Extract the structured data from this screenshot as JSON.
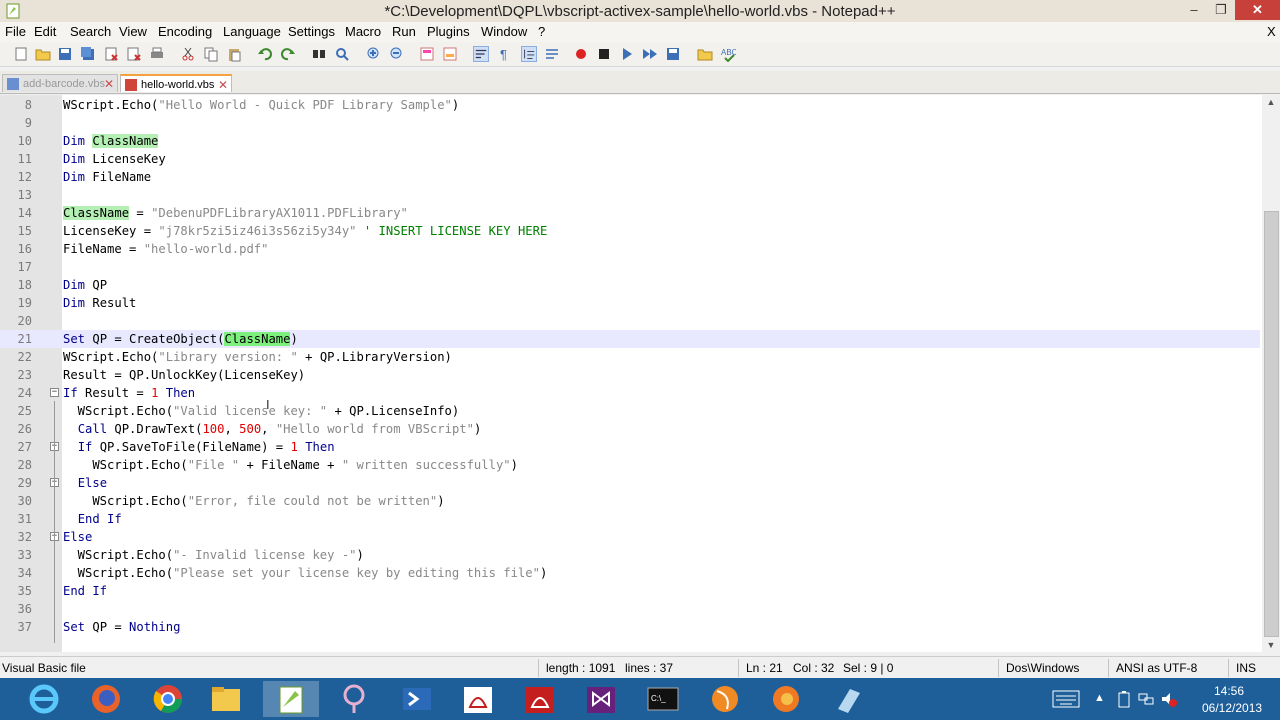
{
  "window": {
    "title": "*C:\\Development\\DQPL\\vbscript-activex-sample\\hello-world.vbs - Notepad++",
    "min": "–",
    "max": "❐",
    "close": "✕"
  },
  "menu": {
    "items": [
      "File",
      "Edit",
      "Search",
      "View",
      "Encoding",
      "Language",
      "Settings",
      "Macro",
      "Run",
      "Plugins",
      "Window",
      "?"
    ],
    "close": "X"
  },
  "tabs": [
    {
      "label": "add-barcode.vbs"
    },
    {
      "label": "hello-world.vbs"
    }
  ],
  "tab_close": "✕",
  "editor": {
    "current_line": 21,
    "lines": [
      {
        "n": "8",
        "html": "WScript.Echo(<span class='str'>\"Hello World - Quick PDF Library Sample\"</span>)"
      },
      {
        "n": "9",
        "html": ""
      },
      {
        "n": "10",
        "html": "<span class='kw'>Dim</span> <span class='bm'>ClassName</span>"
      },
      {
        "n": "11",
        "html": "<span class='kw'>Dim</span> LicenseKey"
      },
      {
        "n": "12",
        "html": "<span class='kw'>Dim</span> FileName"
      },
      {
        "n": "13",
        "html": ""
      },
      {
        "n": "14",
        "html": "<span class='bm'>ClassName</span> = <span class='str'>\"DebenuPDFLibraryAX1011.PDFLibrary\"</span>"
      },
      {
        "n": "15",
        "html": "LicenseKey = <span class='str'>\"j78kr5zi5iz46i3s56zi5y34y\"</span> <span class='cmt'>' INSERT LICENSE KEY HERE</span>"
      },
      {
        "n": "16",
        "html": "FileName = <span class='str'>\"hello-world.pdf\"</span>"
      },
      {
        "n": "17",
        "html": ""
      },
      {
        "n": "18",
        "html": "<span class='kw'>Dim</span> QP"
      },
      {
        "n": "19",
        "html": "<span class='kw'>Dim</span> Result"
      },
      {
        "n": "20",
        "html": ""
      },
      {
        "n": "21",
        "html": "<span class='kw'>Set</span> QP = CreateObject(<span class='hl'>ClassName</span>)"
      },
      {
        "n": "22",
        "html": "WScript.Echo(<span class='str'>\"Library version: \"</span> + QP.LibraryVersion)"
      },
      {
        "n": "23",
        "html": "Result = QP.UnlockKey(LicenseKey)"
      },
      {
        "n": "24",
        "html": "<span class='kw'>If</span> Result = <span class='num'>1</span> <span class='kw'>Then</span>"
      },
      {
        "n": "25",
        "html": "  WScript.Echo(<span class='str'>\"Valid license key: \"</span> + QP.LicenseInfo)"
      },
      {
        "n": "26",
        "html": "  <span class='kw'>Call</span> QP.DrawText(<span class='num'>100</span>, <span class='num'>500</span>, <span class='str'>\"Hello world from VBScript\"</span>)"
      },
      {
        "n": "27",
        "html": "  <span class='kw'>If</span> QP.SaveToFile(FileName) = <span class='num'>1</span> <span class='kw'>Then</span>"
      },
      {
        "n": "28",
        "html": "    WScript.Echo(<span class='str'>\"File \"</span> + FileName + <span class='str'>\" written successfully\"</span>)"
      },
      {
        "n": "29",
        "html": "  <span class='kw'>Else</span>"
      },
      {
        "n": "30",
        "html": "    WScript.Echo(<span class='str'>\"Error, file could not be written\"</span>)"
      },
      {
        "n": "31",
        "html": "  <span class='kw'>End If</span>"
      },
      {
        "n": "32",
        "html": "<span class='kw'>Else</span>"
      },
      {
        "n": "33",
        "html": "  WScript.Echo(<span class='str'>\"- Invalid license key -\"</span>)"
      },
      {
        "n": "34",
        "html": "  WScript.Echo(<span class='str'>\"Please set your license key by editing this file\"</span>)"
      },
      {
        "n": "35",
        "html": "<span class='kw'>End If</span>"
      },
      {
        "n": "36",
        "html": ""
      },
      {
        "n": "37",
        "html": "<span class='kw'>Set</span> QP = <span class='kw'>Nothing</span>"
      }
    ]
  },
  "status": {
    "language": "Visual Basic file",
    "length": "length : 1091",
    "lines": "lines : 37",
    "ln": "Ln : 21",
    "col": "Col : 32",
    "sel": "Sel : 9 | 0",
    "eol": "Dos\\Windows",
    "encoding": "ANSI as UTF-8",
    "mode": "INS"
  },
  "clock": {
    "time": "14:56",
    "date": "06/12/2013"
  },
  "colors": {
    "accent": "#1e5f9a",
    "close": "#c7413a",
    "keyword": "#00008b",
    "string": "#888888",
    "number": "#e00000",
    "comment": "#008000"
  }
}
